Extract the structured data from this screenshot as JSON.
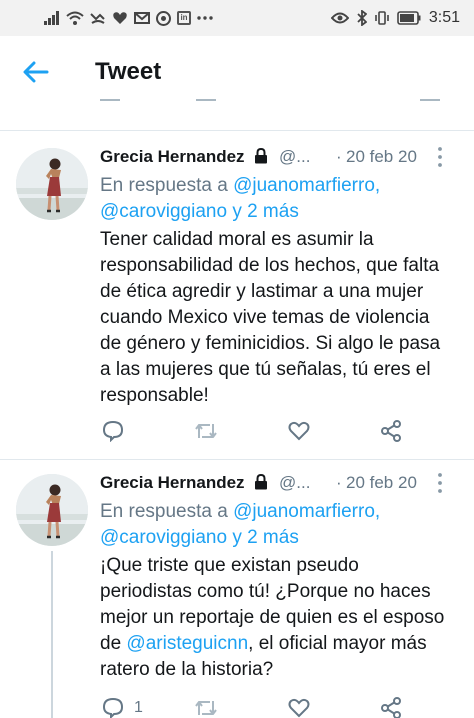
{
  "status_bar": {
    "time": "3:51",
    "battery_level": ""
  },
  "header": {
    "title": "Tweet"
  },
  "tweets": [
    {
      "author_name": "Grecia Hernandez",
      "handle": "@...",
      "separator": "·",
      "date": "20 feb 20",
      "reply_prefix": "En respuesta a",
      "reply_mention_1": "@juanomarfierro",
      "reply_comma": ",",
      "reply_mention_2": "@caroviggiano",
      "reply_suffix": "y 2 más",
      "text": "Tener calidad moral es asumir la responsabilidad de los hechos, que falta de ética agredir y lastimar a una mujer cuando Mexico vive temas de violencia de género y feminicidios.  Si algo le pasa a las mujeres que tú señalas, tú eres el responsable!",
      "reply_count": "",
      "retweet_count": "",
      "like_count": ""
    },
    {
      "author_name": "Grecia Hernandez",
      "handle": "@...",
      "separator": "·",
      "date": "20 feb 20",
      "reply_prefix": "En respuesta a",
      "reply_mention_1": "@juanomarfierro",
      "reply_comma": ",",
      "reply_mention_2": "@caroviggiano",
      "reply_suffix": "y 2 más",
      "text_part_1": "¡Que triste que existan pseudo periodistas como tú! ¿Porque no haces mejor un reportaje de quien es el esposo de ",
      "text_mention": "@aristeguicnn",
      "text_part_2": ", el oficial mayor más ratero de la historia?",
      "reply_count": "1",
      "retweet_count": "",
      "like_count": ""
    }
  ],
  "colors": {
    "accent": "#1da1f2",
    "muted": "#657786",
    "text": "#14171a",
    "divider": "#e1e8ed"
  }
}
